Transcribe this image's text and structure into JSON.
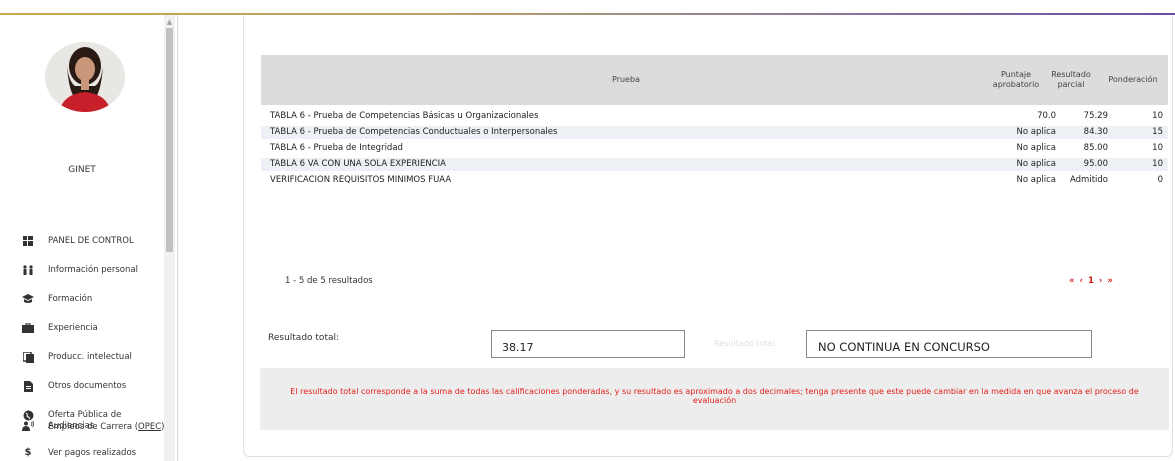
{
  "user": {
    "name": "GINET"
  },
  "sidebar": {
    "items": [
      {
        "label": "PANEL DE CONTROL",
        "icon": "dashboard-icon"
      },
      {
        "label": "Información personal",
        "icon": "people-icon"
      },
      {
        "label": "Formación",
        "icon": "graduation-cap-icon"
      },
      {
        "label": "Experiencia",
        "icon": "briefcase-icon"
      },
      {
        "label": "Producc. intelectual",
        "icon": "publication-icon"
      },
      {
        "label": "Otros documentos",
        "icon": "document-icon"
      },
      {
        "label_line1": "Oferta Pública de",
        "label_line2_prefix": "Empleos de Carrera (",
        "label_line2_link": "OPEC",
        "label_line2_suffix": ")",
        "icon": "globe-icon"
      },
      {
        "label": "Audiencias",
        "icon": "audience-icon"
      },
      {
        "label": "Ver pagos realizados",
        "icon": "dollar-icon"
      }
    ]
  },
  "table": {
    "headers": {
      "prueba": "Prueba",
      "puntaje_1": "Puntaje",
      "puntaje_2": "aprobatorio",
      "resultado_1": "Resultado",
      "resultado_2": "parcial",
      "ponderacion": "Ponderación"
    },
    "rows": [
      {
        "prueba": "TABLA 6 - Prueba de Competencias Básicas u Organizacionales",
        "puntaje": "70.0",
        "resultado": "75.29",
        "ponderacion": "10"
      },
      {
        "prueba": "TABLA 6 - Prueba de Competencias Conductuales o Interpersonales",
        "puntaje": "No aplica",
        "resultado": "84.30",
        "ponderacion": "15"
      },
      {
        "prueba": "TABLA 6 - Prueba de Integridad",
        "puntaje": "No aplica",
        "resultado": "85.00",
        "ponderacion": "10"
      },
      {
        "prueba": "TABLA 6 VA CON UNA SOLA EXPERIENCIA",
        "puntaje": "No aplica",
        "resultado": "95.00",
        "ponderacion": "10"
      },
      {
        "prueba": "VERIFICACION REQUISITOS MINIMOS FUAA",
        "puntaje": "No aplica",
        "resultado": "Admitido",
        "ponderacion": "0"
      }
    ]
  },
  "pagination": {
    "summary": "1 - 5 de 5 resultados",
    "first": "«",
    "prev": "‹",
    "current": "1",
    "next": "›",
    "last": "»"
  },
  "totals": {
    "label": "Resultado total:",
    "value": "38.17",
    "ghost_label": "Resultado total:",
    "status": "NO CONTINUA EN CONCURSO"
  },
  "note": "El resultado total corresponde a la suma de todas las calificaciones ponderadas, y su resultado es aproximado a dos decimales; tenga presente que este puede cambiar en la medida en que avanza el proceso de evaluación",
  "colors": {
    "accent_red": "#d01818",
    "header_gray": "#dcdcdc",
    "row_alt": "#edf0f4"
  }
}
